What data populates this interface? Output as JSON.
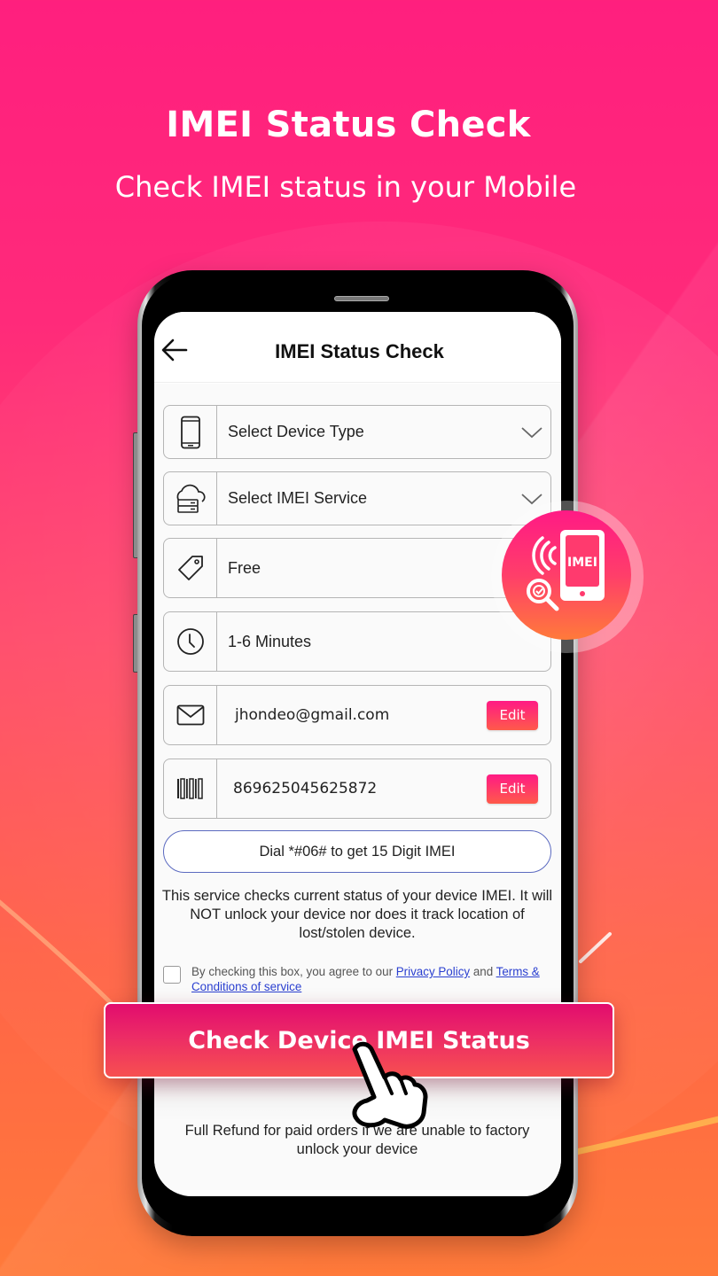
{
  "hero": {
    "title": "IMEI Status Check",
    "subtitle": "Check IMEI status in your Mobile"
  },
  "app": {
    "appbar": {
      "back_icon": "arrow-left-icon",
      "title": "IMEI Status Check"
    },
    "fields": [
      {
        "icon": "smartphone-icon",
        "label": "Select Device Type",
        "type": "dropdown"
      },
      {
        "icon": "cloud-server-icon",
        "label": "Select IMEI Service",
        "type": "dropdown"
      },
      {
        "icon": "price-tag-icon",
        "label": "Free",
        "type": "readonly"
      },
      {
        "icon": "clock-icon",
        "label": "1-6 Minutes",
        "type": "readonly"
      },
      {
        "icon": "mail-icon",
        "label": "jhondeo@gmail.com",
        "type": "editable",
        "action": "Edit"
      },
      {
        "icon": "barcode-icon",
        "label": "869625045625872",
        "type": "editable",
        "action": "Edit"
      }
    ],
    "dial_hint": "Dial *#06# to get 15 Digit IMEI",
    "info_text": "This service checks current status of your device IMEI. It will NOT unlock your device nor does it track location of lost/stolen device.",
    "consent": {
      "checked": false,
      "prefix": "By checking this box, you agree to our ",
      "privacy_link": "Privacy Policy",
      "middle": " and ",
      "terms_link": "Terms & Conditions of service"
    },
    "cta_label": "Check Device IMEI Status",
    "refund_text": "Full Refund for paid orders if we are unable to factory unlock your device"
  },
  "badge": {
    "label": "IMEI",
    "icon": "imei-phone-search-icon"
  },
  "colors": {
    "accent_pink": "#ff1a85",
    "accent_orange": "#ff7a3a",
    "cta_top": "#e20c6e",
    "cta_bottom": "#f75050",
    "link": "#2a3fd0",
    "dial_border": "#5b6ac0"
  }
}
